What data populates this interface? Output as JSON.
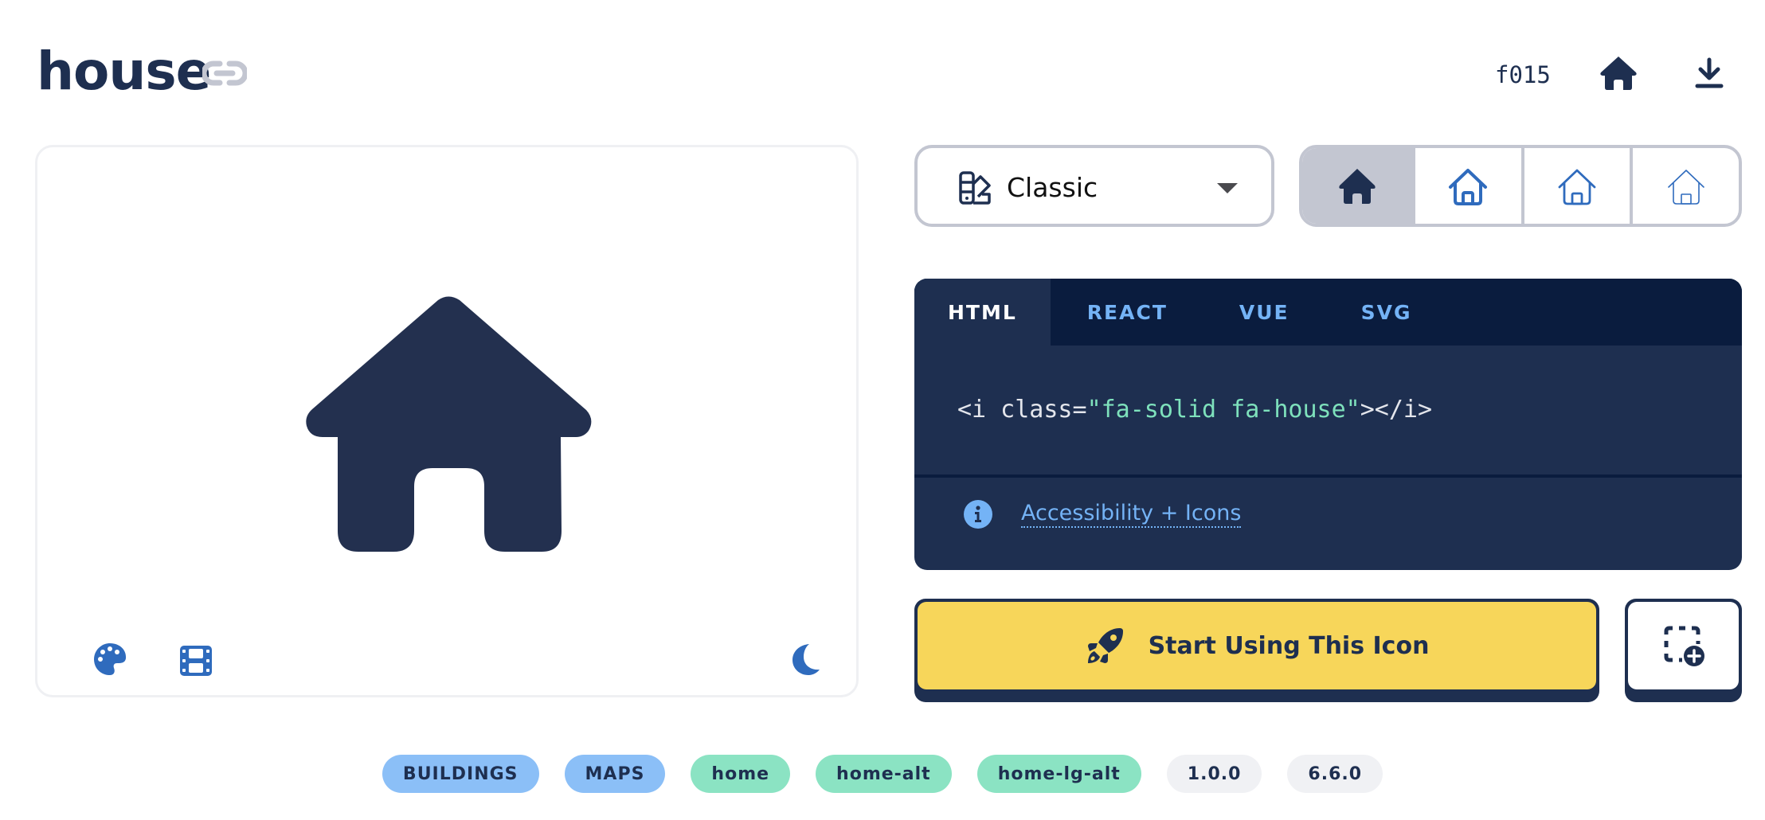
{
  "header": {
    "title": "house",
    "unicode": "f015",
    "icons": [
      "link-icon",
      "house-icon",
      "download-icon"
    ]
  },
  "preview": {
    "icon": "house-icon",
    "tools": [
      "palette-icon",
      "film-icon",
      "moon-icon"
    ]
  },
  "style_select": {
    "icon": "swatchbook-icon",
    "selected": "Classic"
  },
  "variants": [
    {
      "name": "solid",
      "selected": true
    },
    {
      "name": "regular",
      "selected": false
    },
    {
      "name": "light",
      "selected": false
    },
    {
      "name": "thin",
      "selected": false
    }
  ],
  "code": {
    "tabs": [
      "HTML",
      "REACT",
      "VUE",
      "SVG"
    ],
    "active_tab": "HTML",
    "snippet_prefix": "<i class=",
    "snippet_string": "\"fa-solid fa-house\"",
    "snippet_suffix": "></i>",
    "a11y_link": "Accessibility + Icons"
  },
  "actions": {
    "start_label": "Start Using This Icon",
    "add_icon": "square-dashed-circle-plus-icon"
  },
  "tags": {
    "categories": [
      "BUILDINGS",
      "MAPS"
    ],
    "aliases": [
      "home",
      "home-alt",
      "home-lg-alt"
    ],
    "versions": [
      "1.0.0",
      "6.6.0"
    ]
  },
  "colors": {
    "navy": "#1e2f50",
    "dark_navy": "#0a1c3e",
    "accent_blue": "#74b3f6",
    "icon_blue": "#2f6bbd",
    "mint": "#7ee1bc",
    "yellow": "#f7d65a",
    "border_gray": "#c3c6d1"
  }
}
